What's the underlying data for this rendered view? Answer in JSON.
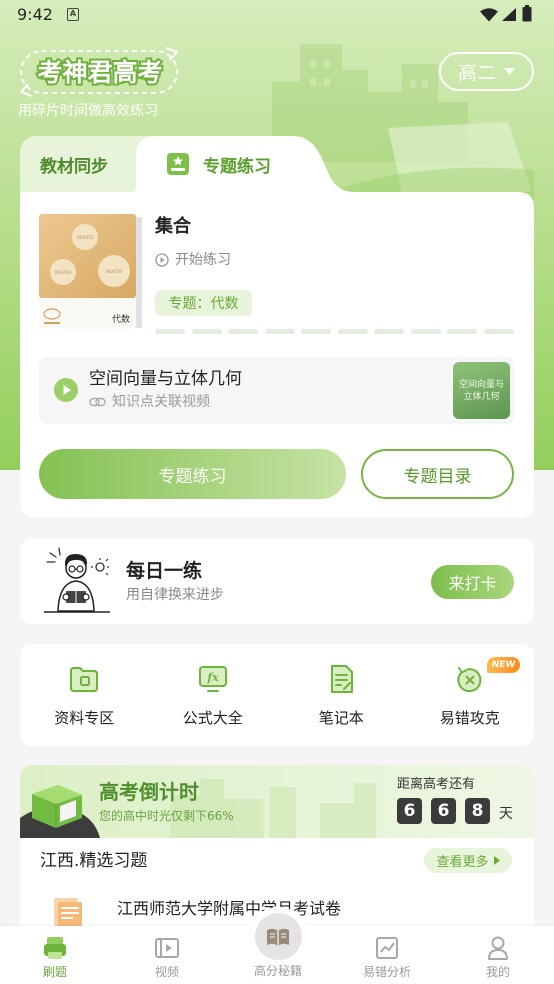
{
  "status_bar": {
    "time": "9:42",
    "notification_icon_text": "A",
    "icons": [
      "wifi-icon",
      "signal-icon",
      "battery-icon"
    ]
  },
  "header": {
    "logo_text": "考神君高考",
    "slogan": "用碎片时间做高效练习",
    "grade_selector": {
      "value": "高二",
      "icon": "caret-down-icon"
    }
  },
  "tabs": [
    {
      "label": "教材同步",
      "active": false
    },
    {
      "label": "专题练习",
      "active": true,
      "icon": "topic-star-icon"
    }
  ],
  "practice_card": {
    "book": {
      "cover_labels": [
        "MATH",
        "MATH",
        "MATH"
      ],
      "subject": "代数"
    },
    "title": "集合",
    "start_label": "开始练习",
    "tag": "专题：代数",
    "progress": {
      "completed_segments": 0,
      "total_segments": 10
    },
    "video": {
      "title": "空间向量与立体几何",
      "subtitle": "知识点关联视频",
      "thumbnail_lines": [
        "空间向量与",
        "立体几何"
      ]
    },
    "primary_button": "专题练习",
    "secondary_button": "专题目录"
  },
  "daily": {
    "title": "每日一练",
    "subtitle": "用自律换来进步",
    "button": "来打卡"
  },
  "quick_links": [
    {
      "label": "资料专区",
      "icon": "folder-icon"
    },
    {
      "label": "公式大全",
      "icon": "formula-icon",
      "icon_text": "fx"
    },
    {
      "label": "笔记本",
      "icon": "notebook-icon"
    },
    {
      "label": "易错攻克",
      "icon": "retry-error-icon",
      "badge": "NEW"
    }
  ],
  "countdown": {
    "title": "高考倒计时",
    "subtitle": "您的高中时光仅剩下66%",
    "remaining_label": "距离高考还有",
    "digits": [
      "6",
      "6",
      "8"
    ],
    "unit": "天"
  },
  "featured": {
    "title": "江西.精选习题",
    "more": "查看更多",
    "items": [
      {
        "title": "江西师范大学附属中学月考试卷",
        "icon": "exam-paper-icon"
      }
    ]
  },
  "bottom_nav": [
    {
      "label": "刷题",
      "icon": "practice-icon",
      "active": true
    },
    {
      "label": "视频",
      "icon": "video-icon",
      "active": false
    },
    {
      "label": "高分秘籍",
      "icon": "book-icon",
      "active": false
    },
    {
      "label": "易错分析",
      "icon": "analysis-icon",
      "active": false
    },
    {
      "label": "我的",
      "icon": "profile-icon",
      "active": false
    }
  ],
  "colors": {
    "primary": "#7cbf4a",
    "primary_dark": "#4f8f2c",
    "tag_bg": "#e7f4da",
    "new_badge": "#ff9a2e",
    "digit_box": "#3b3b3b"
  }
}
